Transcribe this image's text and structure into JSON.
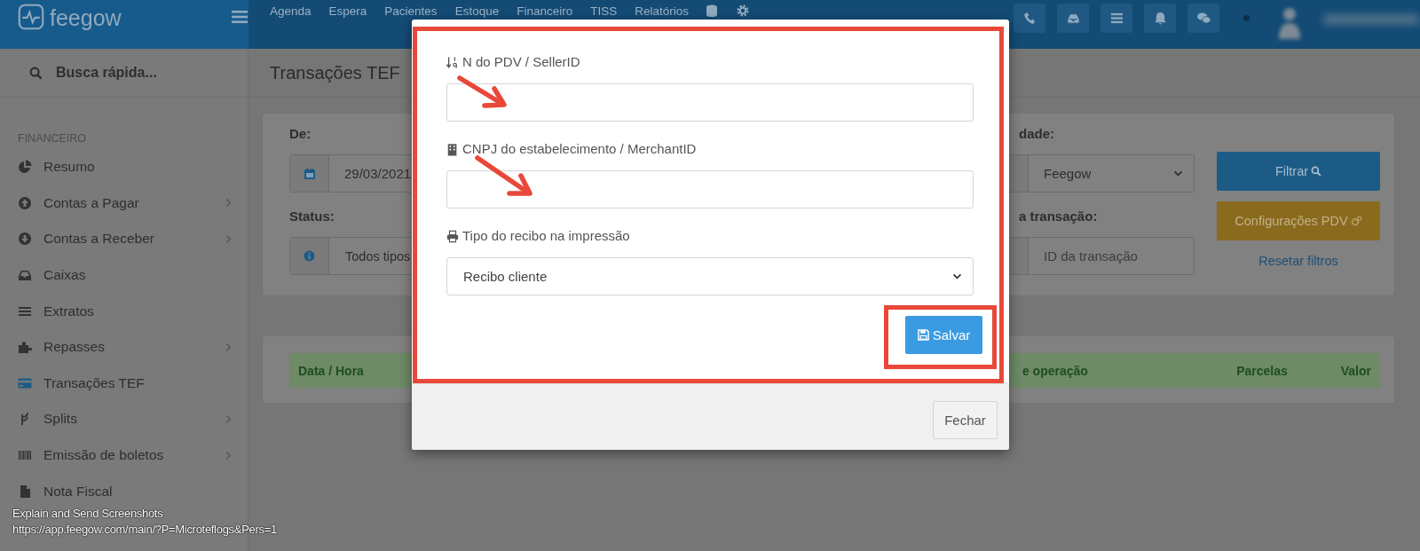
{
  "header": {
    "logo": "feegow",
    "nav": [
      "Agenda",
      "Espera",
      "Pacientes",
      "Estoque",
      "Financeiro",
      "TISS",
      "Relatórios"
    ]
  },
  "sidebar": {
    "search_placeholder": "Busca rápida...",
    "section": "FINANCEIRO",
    "items": [
      {
        "label": "Resumo",
        "has_submenu": false
      },
      {
        "label": "Contas a Pagar",
        "has_submenu": true
      },
      {
        "label": "Contas a Receber",
        "has_submenu": true
      },
      {
        "label": "Caixas",
        "has_submenu": false
      },
      {
        "label": "Extratos",
        "has_submenu": false
      },
      {
        "label": "Repasses",
        "has_submenu": true
      },
      {
        "label": "Transações TEF",
        "has_submenu": false
      },
      {
        "label": "Splits",
        "has_submenu": true
      },
      {
        "label": "Emissão de boletos",
        "has_submenu": true
      },
      {
        "label": "Nota Fiscal",
        "has_submenu": false
      }
    ]
  },
  "page": {
    "title": "Transações TEF"
  },
  "filters": {
    "from_label": "De:",
    "from_value": "29/03/2021",
    "status_label": "Status:",
    "status_value": "Todos tipos",
    "unit_label": "dade:",
    "unit_value": "Feegow",
    "transaction_label": "a transação:",
    "transaction_placeholder": "ID da transação",
    "filter_button": "Filtrar",
    "config_button": "Configurações PDV",
    "reset_link": "Resetar filtros"
  },
  "table": {
    "columns": [
      "Data / Hora",
      "e operação",
      "Parcelas",
      "Valor"
    ]
  },
  "modal": {
    "fields": [
      {
        "kind": "text",
        "label": "N do PDV / SellerID"
      },
      {
        "kind": "text",
        "label": "CNPJ do estabelecimento / MerchantID"
      },
      {
        "kind": "select",
        "label": "Tipo do recibo na impressão",
        "value": "Recibo cliente"
      }
    ],
    "save_button": "Salvar",
    "close_button": "Fechar"
  },
  "capture_overlay": {
    "title": "Explain and Send Screenshots",
    "url": "https://app.feegow.com/main/?P=Microteflogs&Pers=1"
  }
}
